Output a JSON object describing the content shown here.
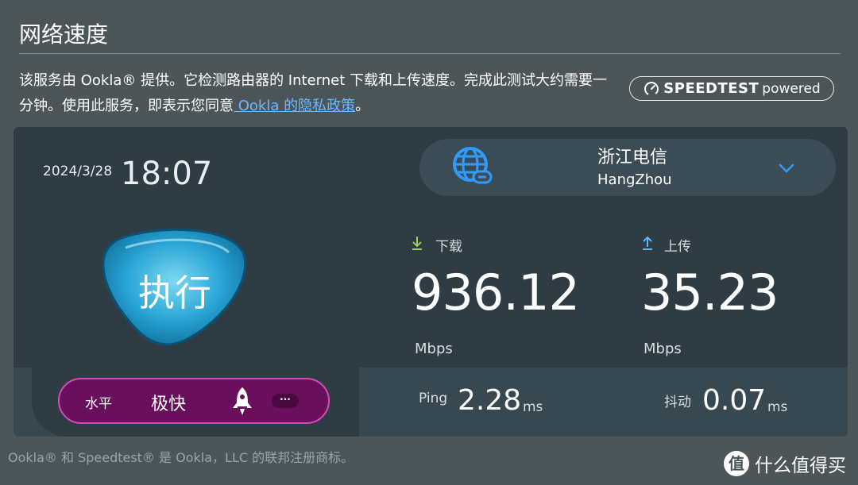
{
  "header": {
    "title": "网络速度",
    "description_1": "该服务由 Ookla® 提供。它检测路由器的 Internet 下载和上传速度。完成此测试大约需要一分钟。使用此服务，即表示您同意",
    "privacy_link": " Ookla 的隐私政策",
    "description_2": "。",
    "badge_brand": "SPEEDTEST",
    "badge_suffix": "powered"
  },
  "status": {
    "date": "2024/3/28",
    "time": "18:07"
  },
  "isp": {
    "name": "浙江电信",
    "city": "HangZhou",
    "icon": "globe-link-icon"
  },
  "go_button": {
    "label": "执行"
  },
  "download": {
    "label": "下载",
    "value": "936.12",
    "unit": "Mbps",
    "icon": "arrow-down-icon"
  },
  "upload": {
    "label": "上传",
    "value": "35.23",
    "unit": "Mbps",
    "icon": "arrow-up-icon"
  },
  "ping": {
    "label": "Ping",
    "value": "2.28",
    "unit": "ms"
  },
  "jitter": {
    "label": "抖动",
    "value": "0.07",
    "unit": "ms"
  },
  "level": {
    "key": "水平",
    "value": "极快",
    "icon": "rocket-icon",
    "more": "···"
  },
  "footer": "Ookla® 和 Speedtest® 是 Ookla，LLC 的联邦注册商标。",
  "watermark": {
    "text": "什么值得买",
    "icon": "smzdm-logo"
  },
  "colors": {
    "background": "#4c5659",
    "panel": "#2f3c44",
    "link": "#6db7ff",
    "accent_blue": "#2f9bff",
    "download_arrow": "#9bd35a",
    "upload_arrow": "#58b6ff",
    "level_pill": "#6a0f5c"
  }
}
